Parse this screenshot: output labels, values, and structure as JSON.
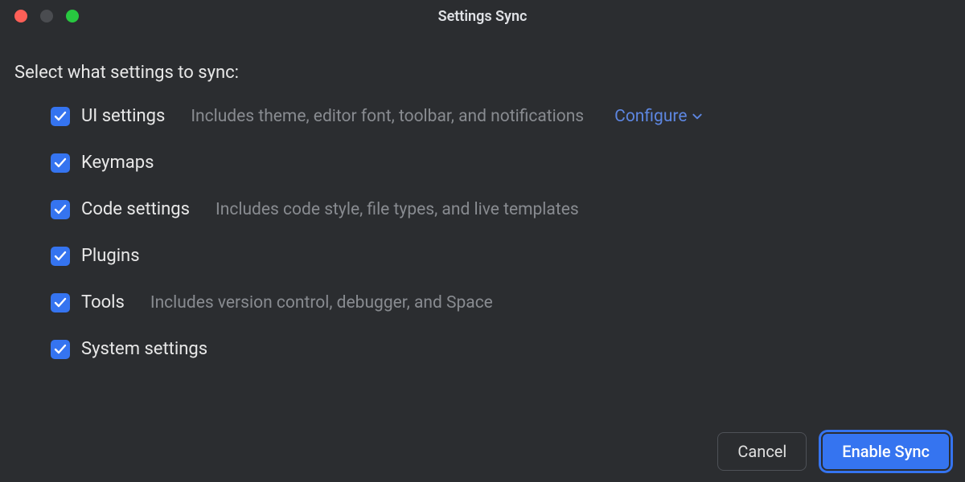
{
  "window": {
    "title": "Settings Sync"
  },
  "lead": "Select what settings to sync:",
  "options": {
    "ui_settings": {
      "label": "UI settings",
      "checked": true,
      "desc": "Includes theme, editor font, toolbar, and notifications",
      "configure_label": "Configure"
    },
    "keymaps": {
      "label": "Keymaps",
      "checked": true,
      "desc": ""
    },
    "code_settings": {
      "label": "Code settings",
      "checked": true,
      "desc": "Includes code style, file types, and live templates"
    },
    "plugins": {
      "label": "Plugins",
      "checked": true,
      "desc": ""
    },
    "tools": {
      "label": "Tools",
      "checked": true,
      "desc": "Includes version control, debugger, and Space"
    },
    "system_settings": {
      "label": "System settings",
      "checked": true,
      "desc": ""
    }
  },
  "footer": {
    "cancel_label": "Cancel",
    "enable_label": "Enable Sync"
  },
  "colors": {
    "accent": "#3574f0",
    "link": "#5d86e0",
    "bg": "#2b2d30",
    "muted": "#888b90"
  }
}
